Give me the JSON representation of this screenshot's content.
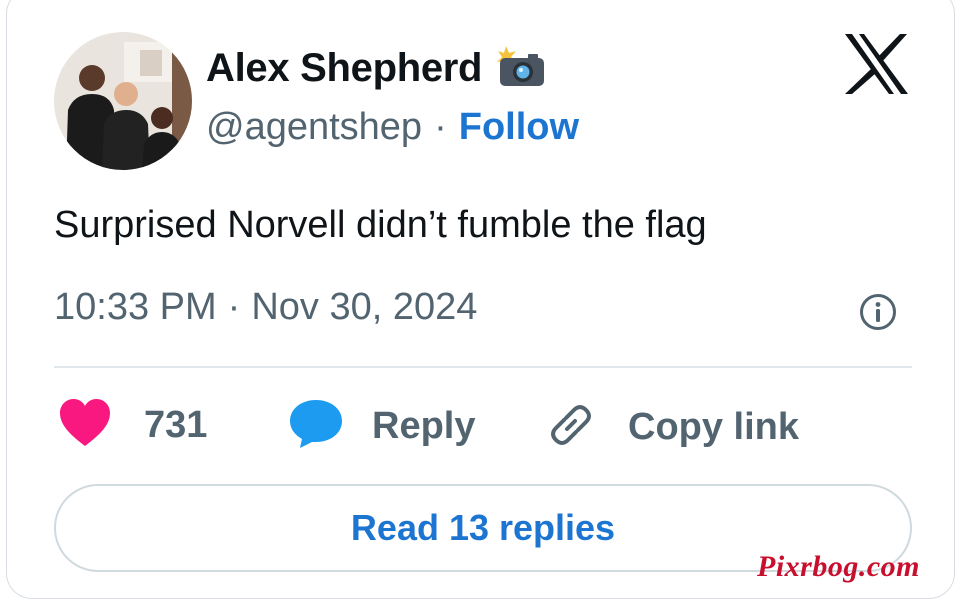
{
  "author": {
    "name": "Alex Shepherd",
    "emoji": "camera-with-flash-icon",
    "handle": "@agentshep",
    "separator": "·",
    "follow_label": "Follow"
  },
  "tweet": {
    "text": "Surprised Norvell didn’t fumble the flag",
    "time": "10:33 PM",
    "separator": "·",
    "date": "Nov 30, 2024"
  },
  "actions": {
    "likes": "731",
    "reply_label": "Reply",
    "copy_link_label": "Copy link"
  },
  "read_replies_label": "Read 13 replies",
  "watermark": "Pixrbog.com",
  "colors": {
    "link_blue": "#1d75d2",
    "like_pink": "#f91880",
    "reply_blue": "#1d9bf0",
    "secondary_text": "#536471",
    "watermark_red": "#c8102e"
  }
}
